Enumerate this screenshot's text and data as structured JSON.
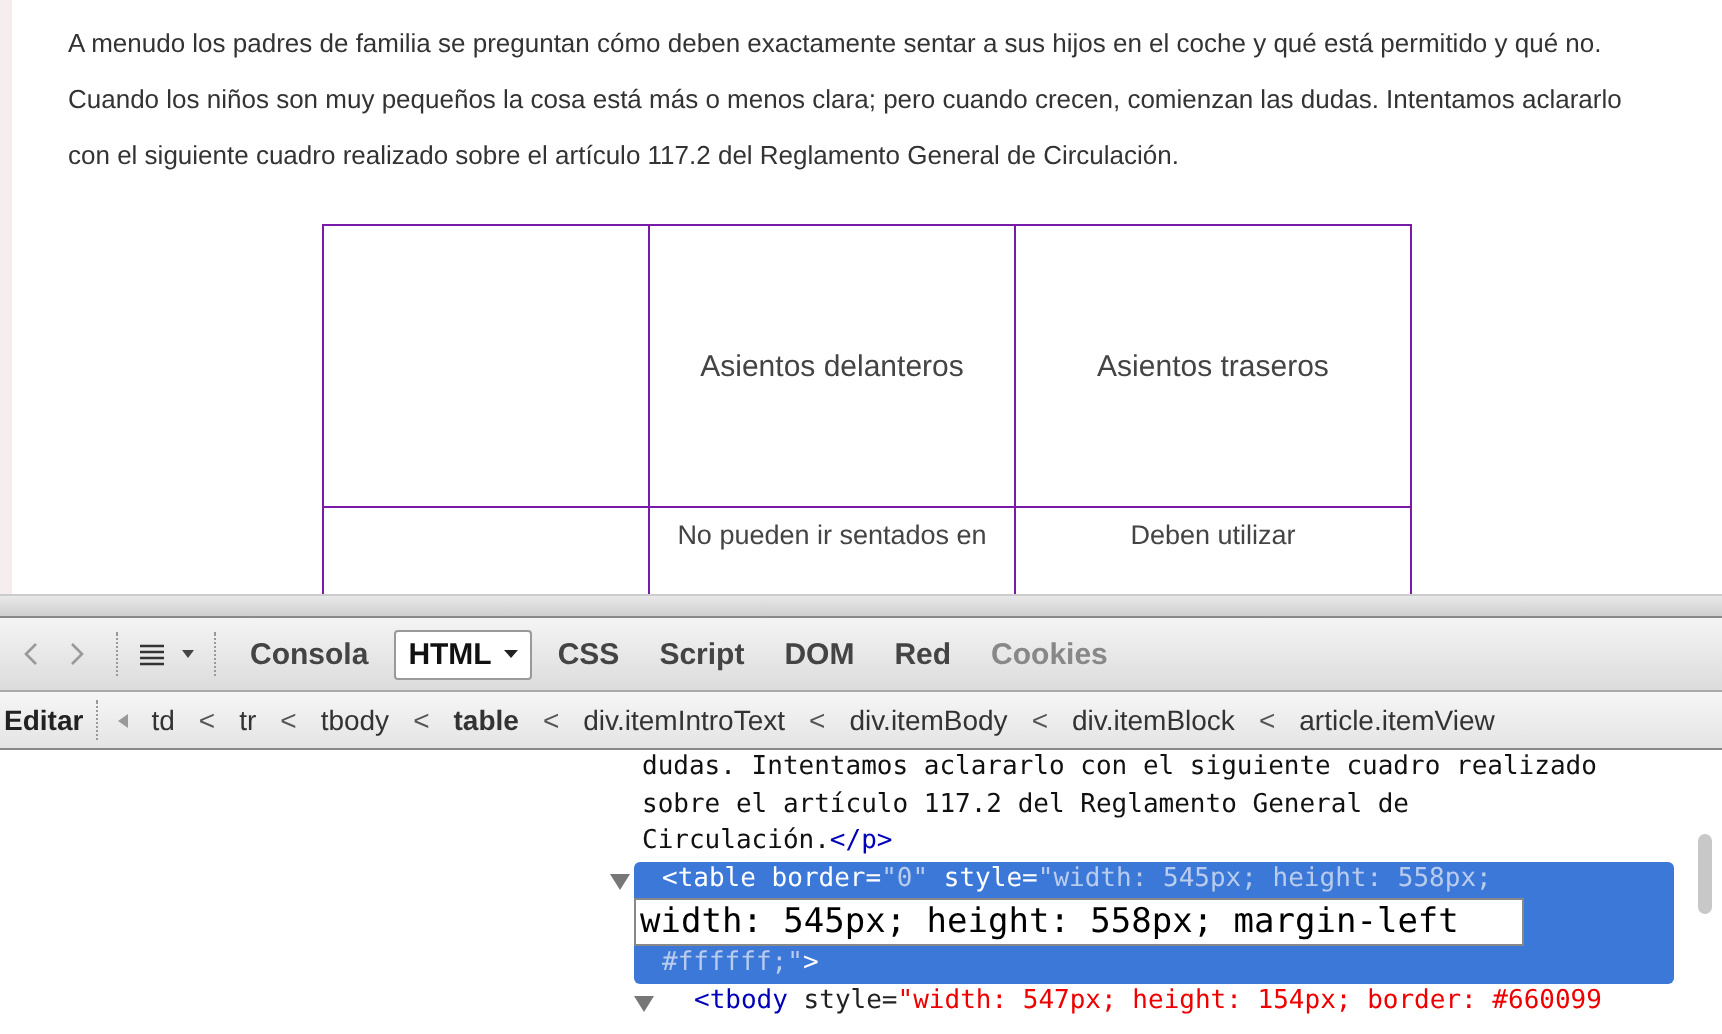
{
  "article": {
    "paragraph": "A menudo los padres de familia se preguntan cómo deben exactamente sentar a sus hijos en el coche y qué está permitido y qué no. Cuando los niños son muy pequeños la cosa está más o menos clara; pero cuando crecen, comienzan las dudas. Intentamos aclararlo con el siguiente cuadro realizado sobre el artículo 117.2 del Reglamento General de Circulación.",
    "table": {
      "columns": [
        "",
        "Asientos delanteros",
        "Asientos traseros"
      ],
      "rows": [
        [
          "",
          "No pueden ir sentados en",
          "Deben utilizar"
        ]
      ]
    }
  },
  "devtools": {
    "tabs": [
      {
        "label": "Consola",
        "selected": false,
        "disabled": false,
        "dropdown": false
      },
      {
        "label": "HTML",
        "selected": true,
        "disabled": false,
        "dropdown": true
      },
      {
        "label": "CSS",
        "selected": false,
        "disabled": false,
        "dropdown": false
      },
      {
        "label": "Script",
        "selected": false,
        "disabled": false,
        "dropdown": false
      },
      {
        "label": "DOM",
        "selected": false,
        "disabled": false,
        "dropdown": false
      },
      {
        "label": "Red",
        "selected": false,
        "disabled": false,
        "dropdown": false
      },
      {
        "label": "Cookies",
        "selected": false,
        "disabled": true,
        "dropdown": false
      }
    ],
    "edit_button": "Editar",
    "breadcrumbs": [
      {
        "label": "td",
        "selected": false
      },
      {
        "label": "tr",
        "selected": false
      },
      {
        "label": "tbody",
        "selected": false
      },
      {
        "label": "table",
        "selected": true
      },
      {
        "label": "div.itemIntroText",
        "selected": false
      },
      {
        "label": "div.itemBody",
        "selected": false
      },
      {
        "label": "div.itemBlock",
        "selected": false
      },
      {
        "label": "article.itemView",
        "selected": false
      }
    ],
    "breadcrumb_separator": "<",
    "html_lines": [
      {
        "twisty": false,
        "selected": false,
        "indent": false,
        "segments": [
          {
            "kind": "text",
            "text": "dudas. Intentamos aclararlo con el siguiente cuadro realizado"
          }
        ]
      },
      {
        "twisty": false,
        "selected": false,
        "indent": false,
        "segments": [
          {
            "kind": "text",
            "text": "sobre el artículo 117.2 del Reglamento General de"
          }
        ]
      },
      {
        "twisty": false,
        "selected": false,
        "indent": false,
        "segments": [
          {
            "kind": "text",
            "text": "Circulación."
          },
          {
            "kind": "tag",
            "text": "</p>"
          }
        ]
      },
      {
        "twisty": true,
        "selected": true,
        "indent": false,
        "segments": [
          {
            "kind": "tag",
            "text": "<table"
          },
          {
            "kind": "attr",
            "text": " border="
          },
          {
            "kind": "value",
            "text": "\"0\""
          },
          {
            "kind": "attr",
            "text": " style="
          },
          {
            "kind": "value",
            "text": "\"width: 545px; height: 558px;"
          }
        ],
        "editor": "width: 545px; height: 558px; margin-left"
      },
      {
        "twisty": false,
        "selected": true,
        "indent": false,
        "segments": [
          {
            "kind": "value",
            "text": "#ffffff;\""
          },
          {
            "kind": "tag",
            "text": ">"
          }
        ]
      },
      {
        "twisty": true,
        "selected": false,
        "indent": true,
        "segments": [
          {
            "kind": "tag",
            "text": "<tbody"
          },
          {
            "kind": "attr",
            "text": " style="
          },
          {
            "kind": "value",
            "text": "\"width: 547px; height: 154px; border: #660099"
          }
        ]
      }
    ]
  }
}
